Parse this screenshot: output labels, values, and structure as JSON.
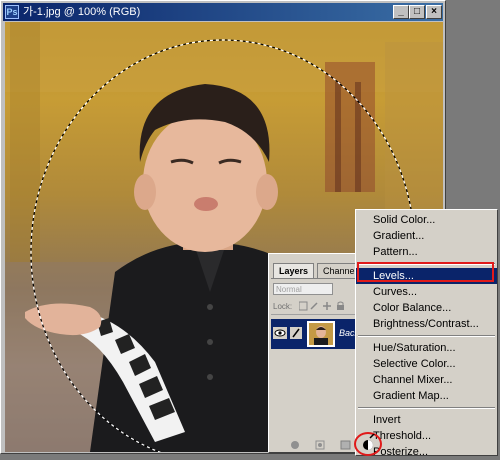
{
  "window": {
    "title": "가-1.jpg @ 100% (RGB)",
    "minimize": "_",
    "maximize": "□",
    "close": "×"
  },
  "layers_panel": {
    "tabs": [
      "Layers",
      "Channels"
    ],
    "blend_mode": "Normal",
    "lock_label": "Lock:",
    "layer_name": "Backgr"
  },
  "menu": {
    "items": [
      "Solid Color...",
      "Gradient...",
      "Pattern...",
      "Levels...",
      "Curves...",
      "Color Balance...",
      "Brightness/Contrast...",
      "Hue/Saturation...",
      "Selective Color...",
      "Channel Mixer...",
      "Gradient Map...",
      "Invert",
      "Threshold...",
      "Posterize..."
    ],
    "selected": "Levels..."
  },
  "colors": {
    "titlebar": "#0a246a",
    "selection": "#0a246a",
    "highlight": "#e01a1a"
  }
}
